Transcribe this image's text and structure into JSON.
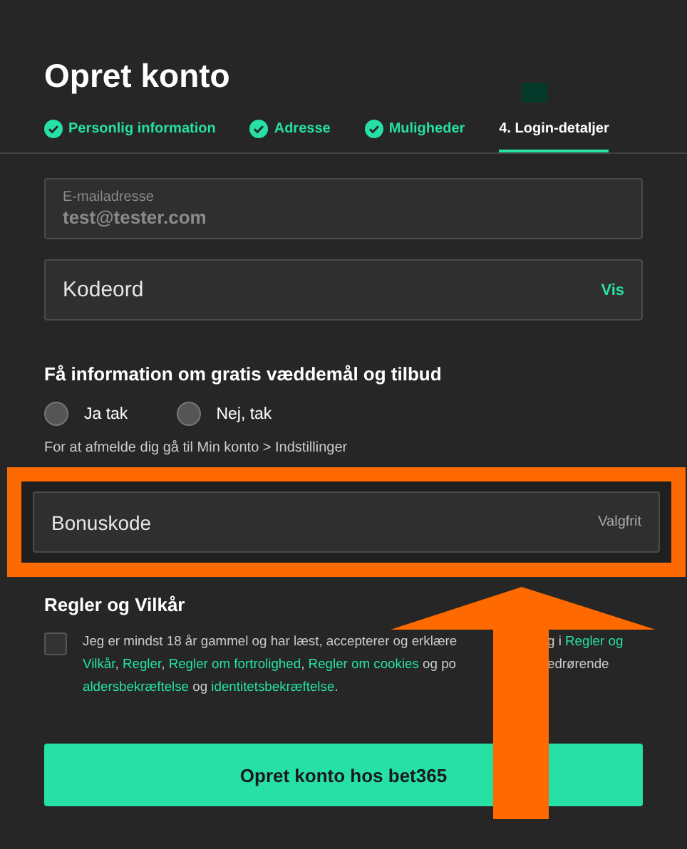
{
  "title": "Opret konto",
  "steps": [
    {
      "label": "Personlig information",
      "done": true,
      "selected": false
    },
    {
      "label": "Adresse",
      "done": true,
      "selected": false
    },
    {
      "label": "Muligheder",
      "done": true,
      "selected": false
    },
    {
      "label": "4. Login-detaljer",
      "done": false,
      "selected": true
    }
  ],
  "email": {
    "label": "E-mailadresse",
    "value": "test@tester.com"
  },
  "password": {
    "placeholder": "Kodeord",
    "action": "Vis"
  },
  "offers": {
    "heading": "Få information om gratis væddemål og tilbud",
    "options": [
      {
        "label": "Ja tak",
        "selected": false
      },
      {
        "label": "Nej, tak",
        "selected": false
      }
    ],
    "note": "For at afmelde dig gå til Min konto > Indstillinger"
  },
  "bonus": {
    "placeholder": "Bonuskode",
    "hint": "Valgfrit"
  },
  "terms": {
    "heading": "Regler og Vilkår",
    "checked": false,
    "lines": [
      {
        "left": [
          {
            "kind": "text",
            "text": "Jeg er mindst 18 år gammel og har læst, accepterer og erklære"
          }
        ],
        "right": [
          {
            "kind": "text",
            "text": "g i "
          },
          {
            "kind": "link",
            "text": "Regler og"
          }
        ]
      },
      {
        "left": [
          {
            "kind": "link",
            "text": "Vilkår"
          },
          {
            "kind": "text",
            "text": ", "
          },
          {
            "kind": "link",
            "text": "Regler"
          },
          {
            "kind": "text",
            "text": ", "
          },
          {
            "kind": "link",
            "text": "Regler om fortrolighed"
          },
          {
            "kind": "text",
            "text": ", "
          },
          {
            "kind": "link",
            "text": "Regler om cookies"
          },
          {
            "kind": "text",
            "text": " og po"
          }
        ],
        "right": [
          {
            "kind": "text",
            "text": "edrørende"
          }
        ]
      },
      {
        "left": [
          {
            "kind": "link",
            "text": "aldersbekræftelse"
          },
          {
            "kind": "text",
            "text": " og "
          },
          {
            "kind": "link",
            "text": "identitetsbekræftelse"
          },
          {
            "kind": "text",
            "text": "."
          }
        ]
      }
    ]
  },
  "submit": "Opret konto hos bet365"
}
